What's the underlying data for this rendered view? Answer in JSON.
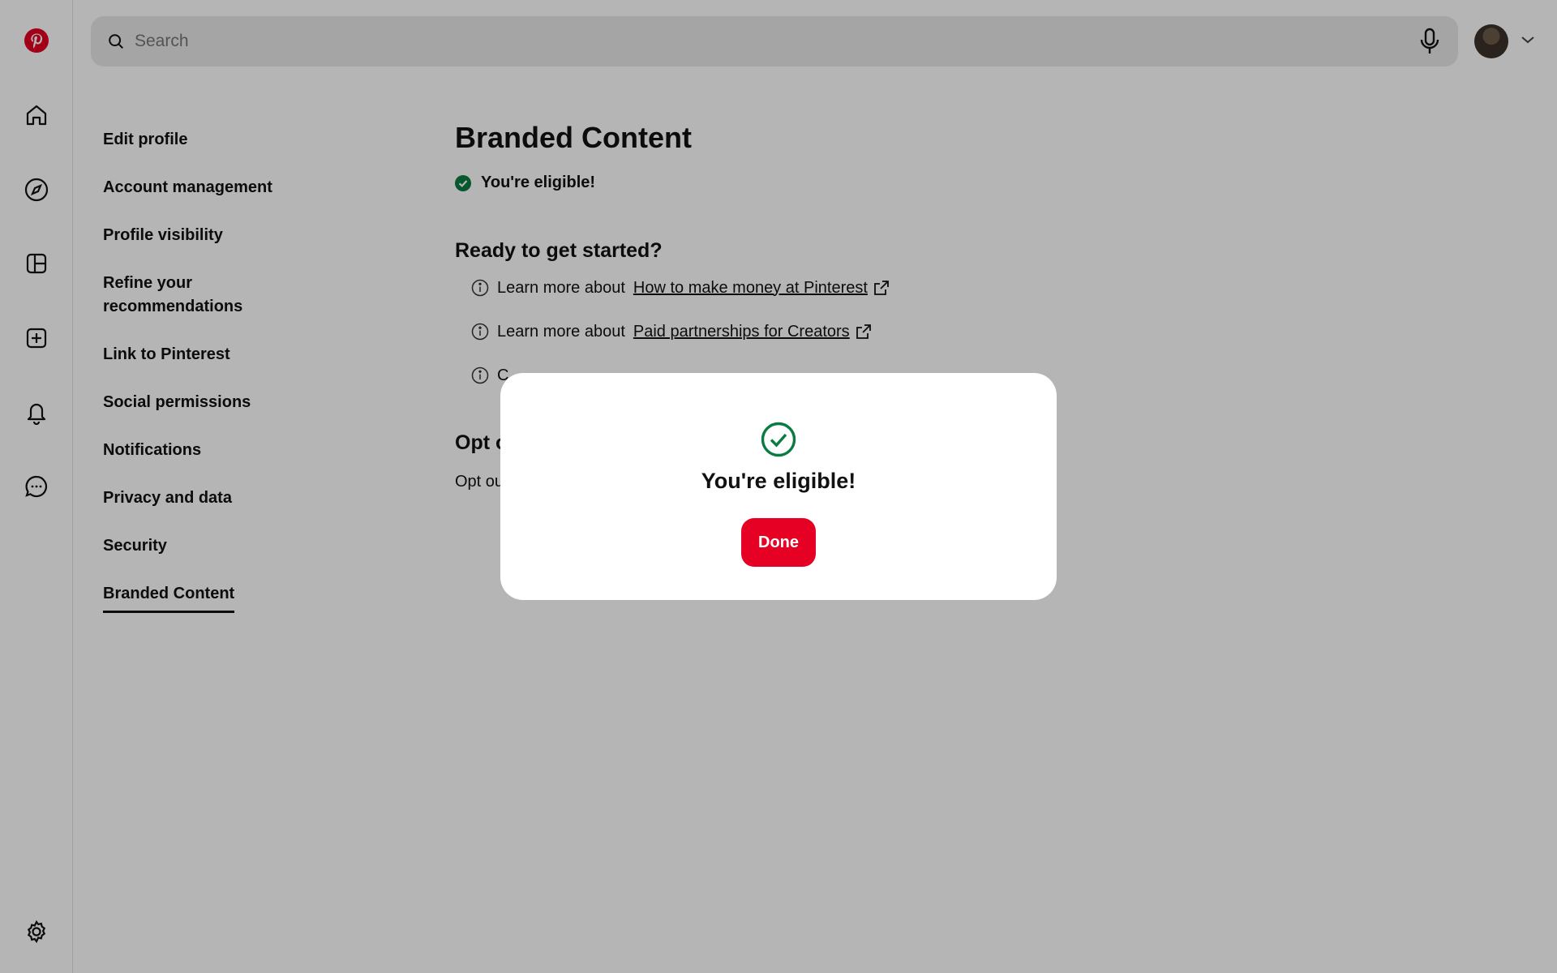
{
  "search": {
    "placeholder": "Search"
  },
  "rail": {
    "logo": "pinterest-logo",
    "items": [
      "home-icon",
      "explore-icon",
      "boards-icon",
      "create-icon",
      "notifications-icon",
      "messages-icon"
    ],
    "settings": "settings-icon"
  },
  "settings_nav": {
    "items": [
      {
        "label": "Edit profile"
      },
      {
        "label": "Account management"
      },
      {
        "label": "Profile visibility"
      },
      {
        "label": "Refine your recommendations"
      },
      {
        "label": "Link to Pinterest"
      },
      {
        "label": "Social permissions"
      },
      {
        "label": "Notifications"
      },
      {
        "label": "Privacy and data"
      },
      {
        "label": "Security"
      },
      {
        "label": "Branded Content",
        "active": true
      }
    ]
  },
  "main": {
    "title": "Branded Content",
    "eligibility": "You're eligible!",
    "section_title": "Ready to get started?",
    "info_rows": [
      {
        "lead": "Learn more about",
        "link": "How to make money at Pinterest"
      },
      {
        "lead": "Learn more about",
        "link": "Paid partnerships for Creators"
      },
      {
        "lead": "C",
        "link": ""
      }
    ],
    "opt_title": "Opt o",
    "opt_text": "Opt ou"
  },
  "modal": {
    "title": "You're eligible!",
    "done_label": "Done"
  },
  "colors": {
    "brand": "#e60023",
    "success": "#0a7b43",
    "overlay": "rgba(0,0,0,0.29)"
  }
}
